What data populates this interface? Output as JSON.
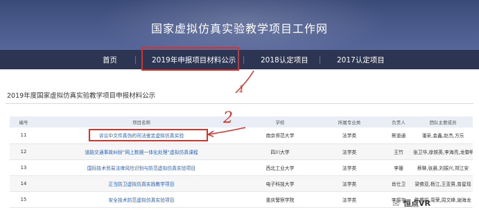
{
  "header": {
    "title": "国家虚拟仿真实验教学项目工作网"
  },
  "nav": {
    "items": [
      "首页",
      "2019年申报项目材料公示",
      "2018认定项目",
      "2017认定项目"
    ]
  },
  "section": {
    "title": "2019年度国家虚拟仿真实验教学项目申报材料公示"
  },
  "table": {
    "headers": [
      "编号",
      "项目名称",
      "学校",
      "所属专业类",
      "负责人",
      "团队主要成员"
    ],
    "rows": [
      [
        "11",
        "诉讼中文件真伪的司法鉴定虚拟仿真实验",
        "南京师范大学",
        "法学类",
        "蔡道通",
        "潘采,金鑫,赵杰,方乐"
      ],
      [
        "12",
        "道路交通事故纠纷“网上数据一体化处理”虚拟仿真课程",
        "四川大学",
        "法学类",
        "王竹",
        "张卫华,徐铁英,李海亮,龙黎明"
      ],
      [
        "13",
        "国际技术贸易法律风险识别与防范虚拟仿真实验项目",
        "西北工业大学",
        "法学类",
        "李珊",
        "蔡琳,张晨,刘振兴,郑江安"
      ],
      [
        "14",
        "正当防卫虚拟仿真实践教学项目",
        "电子科技大学",
        "法学类",
        "肖仕卫",
        "梁佛亚,杨江,王亚男,曾星瑶"
      ],
      [
        "15",
        "安全技术防范虚拟仿真实验项目",
        "重庆警察学院",
        "法学类",
        "李振宇",
        "陈蜀娟,周荣,周文峰,谢海龙"
      ]
    ]
  },
  "annotations": {
    "one": "1",
    "two": "2"
  },
  "watermark": {
    "text": "恒点VR",
    "icon": "wechat-icon"
  },
  "colors": {
    "header": "#3a4a78",
    "nav": "#2c3552",
    "annotation": "#d9312a",
    "link": "#2a62b5"
  }
}
